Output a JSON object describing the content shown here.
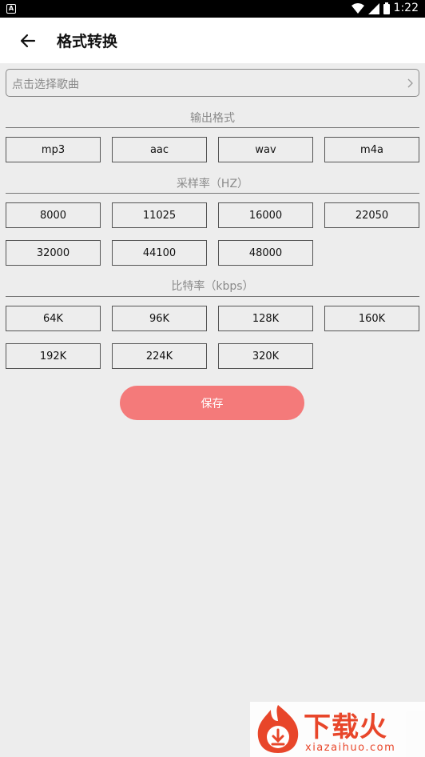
{
  "status_bar": {
    "time": "1:22",
    "notification_icon": "A",
    "icons": [
      "wifi-icon",
      "signal-icon",
      "battery-icon"
    ]
  },
  "header": {
    "title": "格式转换",
    "back_icon": "arrow-left-icon"
  },
  "song_picker": {
    "placeholder": "点击选择歌曲",
    "chevron_icon": "chevron-right-icon"
  },
  "output_format": {
    "title": "输出格式",
    "options": [
      "mp3",
      "aac",
      "wav",
      "m4a"
    ]
  },
  "sample_rate": {
    "title": "采样率（HZ）",
    "options": [
      "8000",
      "11025",
      "16000",
      "22050",
      "32000",
      "44100",
      "48000"
    ]
  },
  "bitrate": {
    "title": "比特率（kbps）",
    "options": [
      "64K",
      "96K",
      "128K",
      "160K",
      "192K",
      "224K",
      "320K"
    ]
  },
  "save_label": "保存",
  "watermark": {
    "brand": "下载火",
    "url": "xiazaihuo.com"
  },
  "colors": {
    "save_button": "#f47a7a",
    "background": "#ededed",
    "watermark": "#e8462a"
  }
}
